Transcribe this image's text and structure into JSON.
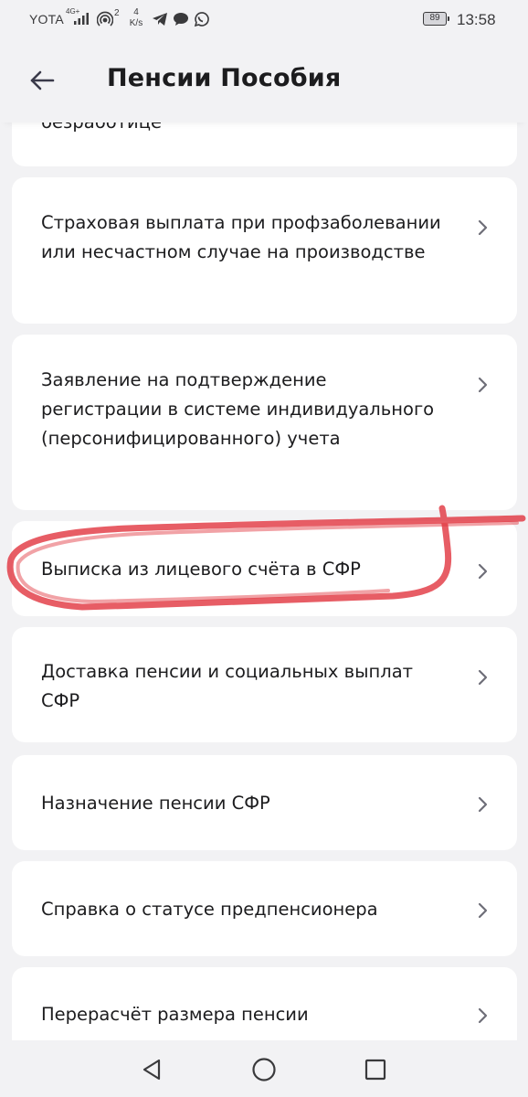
{
  "status_bar": {
    "carrier": "YOTA",
    "network_type": "4G+",
    "hotspot_count": "2",
    "speed_value": "4",
    "speed_unit": "K/s",
    "battery_level": "89",
    "time": "13:58"
  },
  "header": {
    "title": "Пенсии Пособия"
  },
  "services": [
    {
      "label": "безработице"
    },
    {
      "label": "Страховая выплата при профзаболевании или несчастном случае на производстве"
    },
    {
      "label": "Заявление на подтверждение регистрации в системе индивидуального (персонифицированного) учета"
    },
    {
      "label": "Выписка из лицевого счёта в СФР"
    },
    {
      "label": "Доставка пенсии и социальных выплат СФР"
    },
    {
      "label": "Назначение пенсии СФР"
    },
    {
      "label": "Справка о статусе предпенсионера"
    },
    {
      "label": "Перерасчёт размера пенсии"
    }
  ],
  "colors": {
    "background": "#f2f2f4",
    "card": "#ffffff",
    "highlight": "#e0303a"
  }
}
